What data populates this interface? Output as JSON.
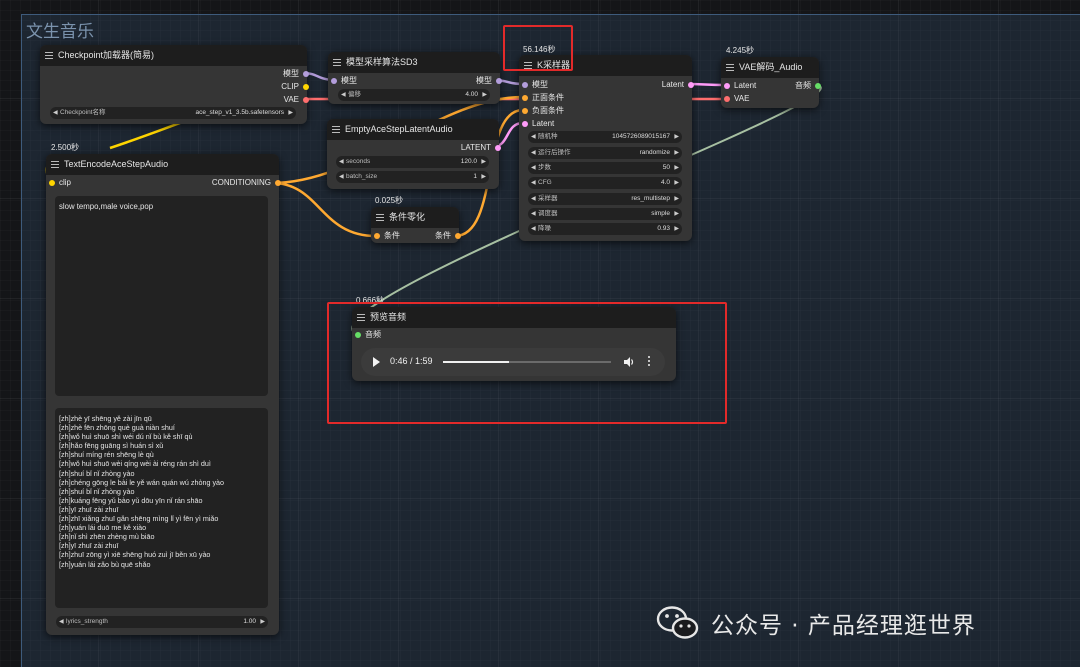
{
  "group": {
    "title": "文生音乐"
  },
  "nodes": {
    "checkpoint": {
      "title": "Checkpoint加载器(简易)",
      "outputs": [
        "模型",
        "CLIP",
        "VAE"
      ],
      "widget": {
        "label": "Checkpoint名称",
        "value": "ace_step_v1_3.5b.safetensors"
      }
    },
    "sampling": {
      "title": "模型采样算法SD3",
      "input": "模型",
      "output": "模型",
      "widget": {
        "label": "偏移",
        "value": "4.00"
      }
    },
    "ksampler": {
      "timing": "56.146秒",
      "title": "K采样器",
      "inputs": [
        "模型",
        "正面条件",
        "负面条件",
        "Latent"
      ],
      "output": "Latent",
      "widgets": [
        {
          "label": "随机种",
          "value": "1045726089015167"
        },
        {
          "label": "运行后操作",
          "value": "randomize"
        },
        {
          "label": "步数",
          "value": "50"
        },
        {
          "label": "CFG",
          "value": "4.0"
        },
        {
          "label": "采样器",
          "value": "res_multistep"
        },
        {
          "label": "调度器",
          "value": "simple"
        },
        {
          "label": "降噪",
          "value": "0.93"
        }
      ]
    },
    "vae": {
      "timing": "4.245秒",
      "title": "VAE解码_Audio",
      "inputs": [
        "Latent",
        "VAE"
      ],
      "output": "音频"
    },
    "latent": {
      "title": "EmptyAceStepLatentAudio",
      "output": "LATENT",
      "widgets": [
        {
          "label": "seconds",
          "value": "120.0"
        },
        {
          "label": "batch_size",
          "value": "1"
        }
      ]
    },
    "textencode": {
      "timing": "2.500秒",
      "title": "TextEncodeAceStepAudio",
      "input": "clip",
      "output": "CONDITIONING",
      "tags": "slow tempo,male voice,pop",
      "lyrics": "[zh]zhè yī shēng yě zài jīn qū\n[zh]zhè fēn zhōng què guà niàn shuí\n[zh]wǒ huì shuō shì wéi dú nǐ bù kě shī qù\n[zh]hǎo fēng guāng sì huán sì xǔ\n[zh]shuí míng rén shēng lè qù\n[zh]wǒ huì shuō wèi qíng wèi ài réng rán shì duì\n[zh]shuí bǐ nǐ zhòng yào\n[zh]chéng gōng le bài le yě wán quán wú zhòng yào\n[zh]shuí bǐ nǐ zhòng yào\n[zh]kuáng fēng yǔ bào yǔ dōu yīn nǐ rán shāo\n[zh]yī zhuī zài zhuī\n[zh]zhī xiǎng zhuī gǎn shēng mìng lǐ yì fēn yì miǎo\n[zh]yuán lái duō me kě xiào\n[zh]nǐ shì zhēn zhèng mù biāo\n[zh]yī zhuī zài zhuī\n[zh]zhuī zōng yì xiē shēng huó zuì jī běn xū yào\n[zh]yuán lái zǎo bù quē shǎo",
      "widget": {
        "label": "lyrics_strength",
        "value": "1.00"
      }
    },
    "zeroout": {
      "timing": "0.025秒",
      "title": "条件零化",
      "input": "条件",
      "output": "条件"
    },
    "preview": {
      "timing": "0.666秒",
      "title": "预览音频",
      "input": "音频",
      "player": {
        "time": "0:46 / 1:59",
        "progress": 0.39
      }
    }
  },
  "watermark": {
    "text": "公众号 · 产品经理逛世界"
  },
  "colors": {
    "model": "#b39ddb",
    "clip": "#ffd500",
    "vae": "#ff6e6e",
    "conditioning": "#ffa931",
    "latent": "#ff9cf9",
    "audio": "#66dd66",
    "highlight": "#e32a2a"
  }
}
